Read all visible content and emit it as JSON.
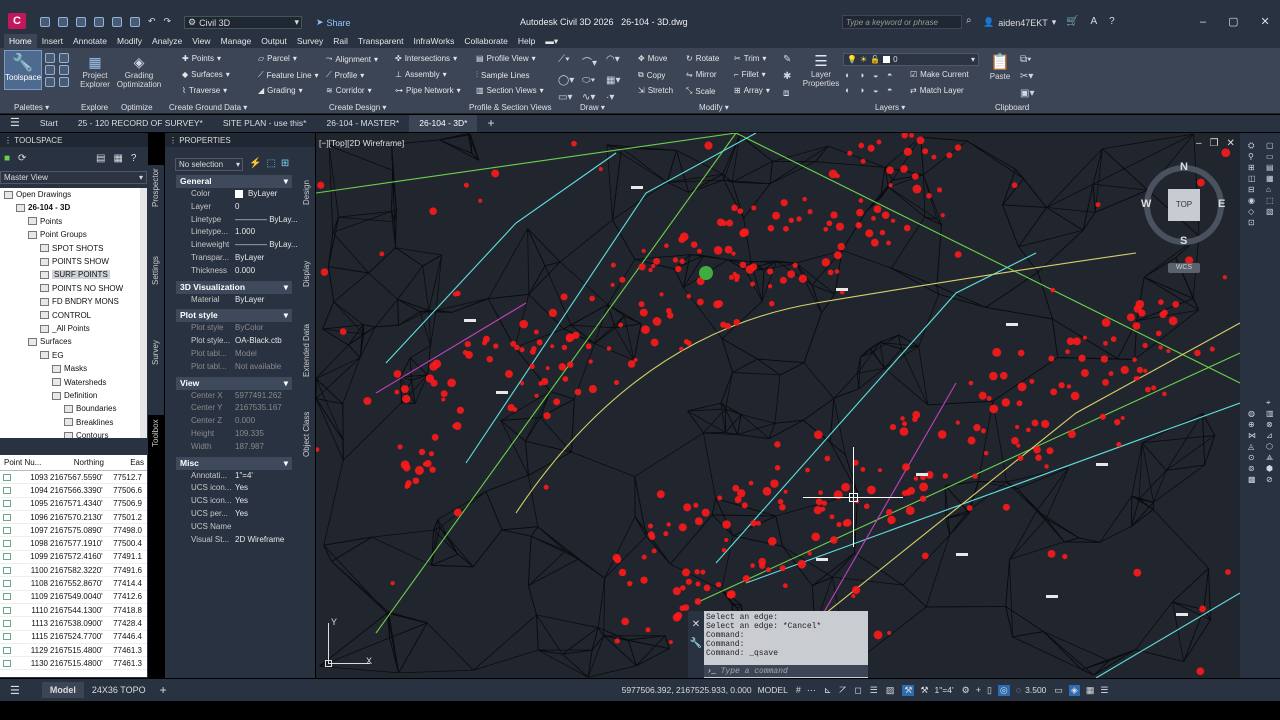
{
  "app": {
    "title": "Autodesk Civil 3D 2026",
    "file": "26-104 - 3D.dwg",
    "workspace": "Civil 3D",
    "share": "Share",
    "search_placeholder": "Type a keyword or phrase",
    "user": "aiden47EKT",
    "logo": "C"
  },
  "ribbon_tabs": [
    "Home",
    "Insert",
    "Annotate",
    "Modify",
    "Analyze",
    "View",
    "Manage",
    "Output",
    "Survey",
    "Rail",
    "Transparent",
    "InfraWorks",
    "Collaborate",
    "Help"
  ],
  "ribbon": {
    "toolspace": "Toolspace",
    "palettes": "Palettes",
    "project_explorer": "Project Explorer",
    "explore": "Explore",
    "grading_optimization": "Grading Optimization",
    "optimize": "Optimize",
    "points": "Points",
    "surfaces": "Surfaces",
    "traverse": "Traverse",
    "parcel": "Parcel",
    "feature_line": "Feature Line",
    "grading": "Grading",
    "create_ground_data": "Create Ground Data",
    "alignment": "Alignment",
    "profile": "Profile",
    "corridor": "Corridor",
    "intersections": "Intersections",
    "assembly": "Assembly",
    "pipe_network": "Pipe Network",
    "create_design": "Create Design",
    "profile_view": "Profile View",
    "sample_lines": "Sample Lines",
    "section_views": "Section Views",
    "profile_section_views": "Profile & Section Views",
    "draw": "Draw",
    "move": "Move",
    "rotate": "Rotate",
    "trim": "Trim",
    "copy": "Copy",
    "mirror": "Mirror",
    "fillet": "Fillet",
    "stretch": "Stretch",
    "scale": "Scale",
    "array": "Array",
    "modify": "Modify",
    "layer_properties": "Layer Properties",
    "layer_value": "0",
    "make_current": "Make Current",
    "match_layer": "Match Layer",
    "layers": "Layers",
    "paste": "Paste",
    "clipboard": "Clipboard"
  },
  "doc_tabs": [
    "Start",
    "25 - 120 RECORD OF SURVEY*",
    "SITE PLAN - use this*",
    "26-104 - MASTER*",
    "26-104 - 3D*"
  ],
  "toolspace": {
    "title": "TOOLSPACE",
    "view": "Master View",
    "tree": [
      {
        "label": "Open Drawings",
        "indent": 0
      },
      {
        "label": "26-104 - 3D",
        "indent": 1,
        "bold": true
      },
      {
        "label": "Points",
        "indent": 2
      },
      {
        "label": "Point Groups",
        "indent": 2
      },
      {
        "label": "SPOT SHOTS",
        "indent": 3
      },
      {
        "label": "POINTS SHOW",
        "indent": 3
      },
      {
        "label": "SURF POINTS",
        "indent": 3,
        "selected": true
      },
      {
        "label": "POINTS NO SHOW",
        "indent": 3
      },
      {
        "label": "FD BNDRY MONS",
        "indent": 3
      },
      {
        "label": "CONTROL",
        "indent": 3
      },
      {
        "label": "_All Points",
        "indent": 3
      },
      {
        "label": "Surfaces",
        "indent": 2
      },
      {
        "label": "EG",
        "indent": 3
      },
      {
        "label": "Masks",
        "indent": 4
      },
      {
        "label": "Watersheds",
        "indent": 4
      },
      {
        "label": "Definition",
        "indent": 4
      },
      {
        "label": "Boundaries",
        "indent": 5
      },
      {
        "label": "Breaklines",
        "indent": 5
      },
      {
        "label": "Contours",
        "indent": 5
      }
    ],
    "side_tabs": [
      "Prospector",
      "Settings",
      "Survey",
      "Toolbox"
    ],
    "grid_headers": [
      "Point Nu...",
      "Northing",
      "Eas"
    ],
    "grid_rows": [
      [
        "1093",
        "2167567.5590'",
        "77512.7"
      ],
      [
        "1094",
        "2167566.3390'",
        "77506.6"
      ],
      [
        "1095",
        "2167571.4340'",
        "77506.9"
      ],
      [
        "1096",
        "2167570.2130'",
        "77501.2"
      ],
      [
        "1097",
        "2167575.0890'",
        "77498.0"
      ],
      [
        "1098",
        "2167577.1910'",
        "77500.4"
      ],
      [
        "1099",
        "2167572.4160'",
        "77491.1"
      ],
      [
        "1100",
        "2167582.3220'",
        "77491.6"
      ],
      [
        "1108",
        "2167552.8670'",
        "77414.4"
      ],
      [
        "1109",
        "2167549.0040'",
        "77412.6"
      ],
      [
        "1110",
        "2167544.1300'",
        "77418.8"
      ],
      [
        "1113",
        "2167538.0900'",
        "77428.4"
      ],
      [
        "1115",
        "2167524.7700'",
        "77446.4"
      ],
      [
        "1129",
        "2167515.4800'",
        "77461.3"
      ],
      [
        "1130",
        "2167515.4800'",
        "77461.3"
      ]
    ]
  },
  "properties": {
    "title": "PROPERTIES",
    "selection": "No selection",
    "side_tabs": [
      "Design",
      "Display",
      "Extended Data",
      "Object Class"
    ],
    "sections": {
      "general": "General",
      "viz": "3D Visualization",
      "plot": "Plot style",
      "view": "View",
      "misc": "Misc"
    },
    "general": [
      [
        "Color",
        "ByLayer"
      ],
      [
        "Layer",
        "0"
      ],
      [
        "Linetype",
        "———— ByLay..."
      ],
      [
        "Linetype...",
        "1.000"
      ],
      [
        "Lineweight",
        "———— ByLay..."
      ],
      [
        "Transpar...",
        "ByLayer"
      ],
      [
        "Thickness",
        "0.000"
      ]
    ],
    "viz": [
      [
        "Material",
        "ByLayer"
      ]
    ],
    "plot": [
      [
        "Plot style",
        "ByColor"
      ],
      [
        "Plot style...",
        "OA-Black.ctb"
      ],
      [
        "Plot tabl...",
        "Model"
      ],
      [
        "Plot tabl...",
        "Not available"
      ]
    ],
    "view": [
      [
        "Center X",
        "5977491.262"
      ],
      [
        "Center Y",
        "2167535.167"
      ],
      [
        "Center Z",
        "0.000"
      ],
      [
        "Height",
        "109.335"
      ],
      [
        "Width",
        "187.987"
      ]
    ],
    "misc": [
      [
        "Annotati...",
        "1\"=4'"
      ],
      [
        "UCS icon...",
        "Yes"
      ],
      [
        "UCS icon...",
        "Yes"
      ],
      [
        "UCS per...",
        "Yes"
      ],
      [
        "UCS Name",
        ""
      ],
      [
        "Visual St...",
        "2D Wireframe"
      ]
    ]
  },
  "viewport": {
    "label": "[−][Top][2D Wireframe]",
    "compass": {
      "n": "N",
      "s": "S",
      "e": "E",
      "w": "W",
      "top": "TOP",
      "wcs": "WCS"
    },
    "ucs_x": "X",
    "ucs_y": "Y"
  },
  "command": {
    "lines": [
      "Select an edge:",
      "Select an edge: *Cancel*",
      "Command:",
      "Command:",
      "Command: _qsave"
    ],
    "placeholder": "Type a command"
  },
  "status": {
    "model_tab": "Model",
    "layout_tab": "24X36 TOPO",
    "coords": "5977506.392, 2167525.933, 0.000",
    "space": "MODEL",
    "scale": "1\"=4'",
    "value": "3.500"
  },
  "colors": {
    "accent": "#c2185b",
    "red": "#ff1a1a",
    "cyan": "#5fe0e0",
    "green": "#6bd14b",
    "yellow": "#d6d26a"
  }
}
